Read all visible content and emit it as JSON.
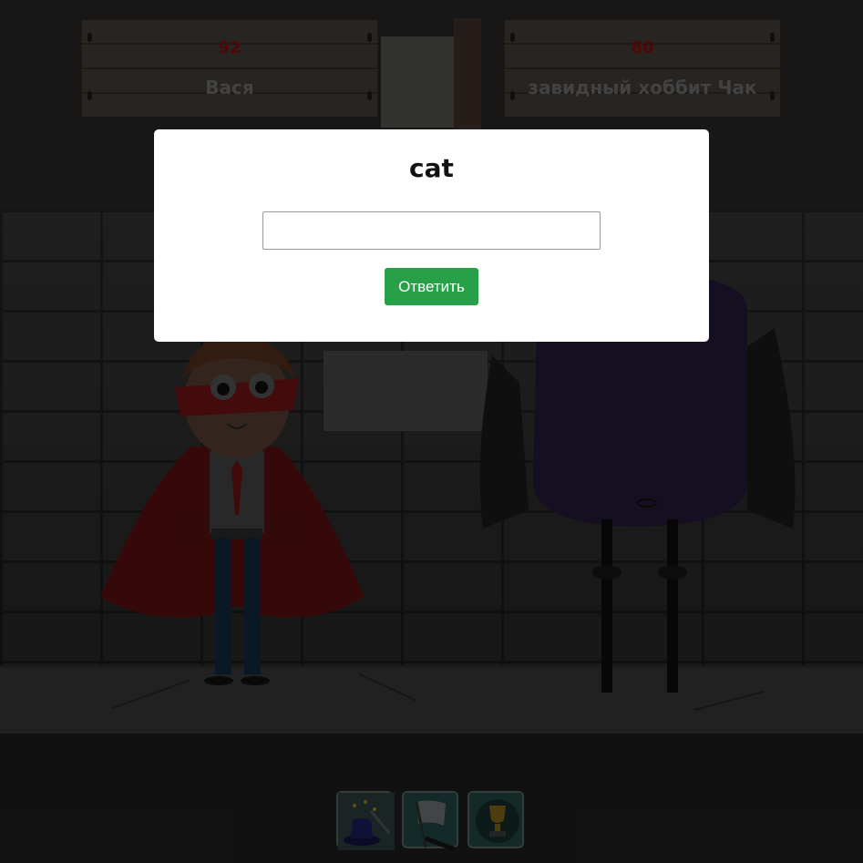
{
  "players": [
    {
      "score": "92",
      "name": "Вася"
    },
    {
      "score": "80",
      "name": "завидный хоббит Чак"
    }
  ],
  "question": {
    "word": "cat",
    "input_value": "",
    "input_placeholder": ""
  },
  "actions": {
    "answer_label": "Ответить"
  },
  "powerups": [
    {
      "icon": "magic-hat-icon"
    },
    {
      "icon": "white-flag-icon"
    },
    {
      "icon": "trophy-icon"
    }
  ],
  "colors": {
    "answer_button": "#28a047",
    "score": "#5a0808",
    "modal_bg": "#ffffff"
  }
}
